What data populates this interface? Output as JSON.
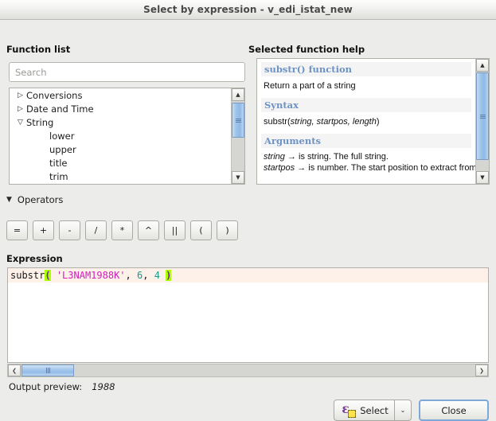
{
  "window": {
    "title": "Select by expression - v_edi_istat_new"
  },
  "function_list": {
    "label": "Function list",
    "search": {
      "placeholder": "Search",
      "value": ""
    },
    "tree": [
      {
        "label": "Conversions",
        "level": 0,
        "expanded": false,
        "twisty": "▷"
      },
      {
        "label": "Date and Time",
        "level": 0,
        "expanded": false,
        "twisty": "▷"
      },
      {
        "label": "String",
        "level": 0,
        "expanded": true,
        "twisty": "▽"
      },
      {
        "label": "lower",
        "level": 1,
        "twisty": ""
      },
      {
        "label": "upper",
        "level": 1,
        "twisty": ""
      },
      {
        "label": "title",
        "level": 1,
        "twisty": ""
      },
      {
        "label": "trim",
        "level": 1,
        "twisty": ""
      }
    ],
    "scrollbar": {
      "up_arrow": "▲",
      "down_arrow": "▼"
    }
  },
  "help": {
    "label": "Selected function help",
    "function_heading": "substr() function",
    "description": "Return a part of a string",
    "syntax_heading": "Syntax",
    "syntax_prefix": "substr(",
    "syntax_params": "string, startpos, length",
    "syntax_suffix": ")",
    "arguments_heading": "Arguments",
    "arguments": [
      {
        "name": "string",
        "arrow": "→",
        "text": "is string. The full string."
      },
      {
        "name": "startpos",
        "arrow": "→",
        "text": "is number. The start position to extract from"
      }
    ],
    "scrollbar": {
      "up_arrow": "▲",
      "down_arrow": "▼"
    }
  },
  "operators": {
    "label": "Operators",
    "twisty": "▼",
    "buttons": [
      "=",
      "+",
      "-",
      "/",
      "*",
      "^",
      "||",
      "(",
      ")"
    ]
  },
  "expression": {
    "label": "Expression",
    "text": "substr( 'L3NAM1988K', 6, 4 )",
    "tokens": [
      {
        "text": "substr",
        "type": "fn"
      },
      {
        "text": "(",
        "type": "paren"
      },
      {
        "text": " ",
        "type": "punct"
      },
      {
        "text": "'L3NAM1988K'",
        "type": "str"
      },
      {
        "text": ",",
        "type": "punct"
      },
      {
        "text": " ",
        "type": "punct"
      },
      {
        "text": "6",
        "type": "num"
      },
      {
        "text": ",",
        "type": "punct"
      },
      {
        "text": " ",
        "type": "punct"
      },
      {
        "text": "4",
        "type": "num"
      },
      {
        "text": " ",
        "type": "punct"
      },
      {
        "text": ")",
        "type": "paren"
      }
    ],
    "scrollbar": {
      "left_arrow": "❮",
      "right_arrow": "❯"
    }
  },
  "output_preview": {
    "label": "Output preview:",
    "value": "1988"
  },
  "buttons": {
    "select": "Select",
    "select_dropdown_arrow": "⌄",
    "close": "Close"
  },
  "colors": {
    "heading_blue": "#6d92c4",
    "string_literal": "#cc22bb",
    "number_literal": "#179a8e",
    "bracket_match_bg": "#aaff00",
    "bracket_match_fg": "#7a1fa2",
    "current_line_bg": "#fdf1e9",
    "scrollbar_thumb": "#9dc3ea",
    "focus_border": "#7ea8d8",
    "select_icon_purple": "#7a3d96",
    "select_icon_yellow": "#ffe34d"
  }
}
